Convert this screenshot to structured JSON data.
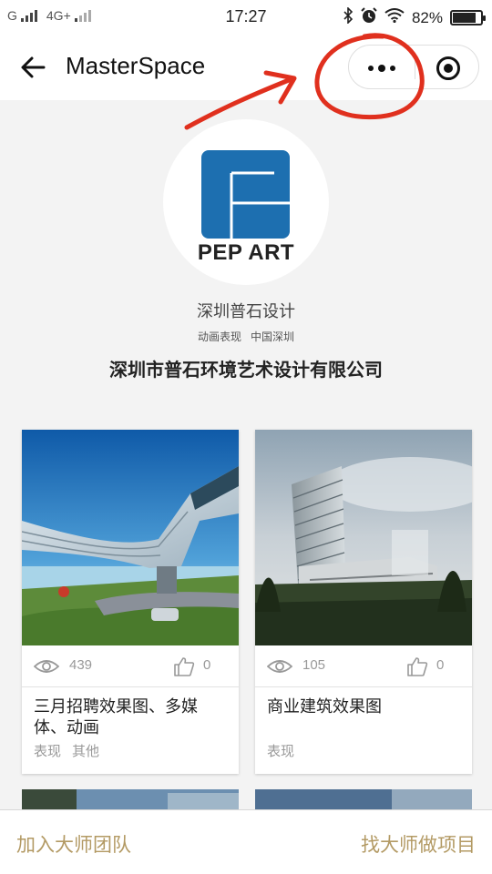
{
  "status_bar": {
    "carrier1": "G",
    "network": "4G+",
    "time": "17:27",
    "battery_pct": "82%",
    "battery_level": 0.82
  },
  "nav": {
    "title": "MasterSpace",
    "icons": [
      "back-arrow-icon",
      "more-icon",
      "close-target-icon"
    ]
  },
  "profile": {
    "logo_text": "PEP ART",
    "name": "深圳普石设计",
    "tags": [
      "动画表现",
      "中国深圳"
    ],
    "company": "深圳市普石环境艺术设计有限公司",
    "logo_color": "#1d6fb0"
  },
  "cards": [
    {
      "views": "439",
      "likes": "0",
      "title": "三月招聘效果图、多媒体、动画",
      "tags": [
        "表现",
        "其他"
      ]
    },
    {
      "views": "105",
      "likes": "0",
      "title": "商业建筑效果图",
      "tags": [
        "表现"
      ]
    }
  ],
  "bottom_bar": {
    "join": "加入大师团队",
    "hire": "找大师做项目",
    "accent": "#b39a64"
  },
  "annotation_color": "#e0301e"
}
